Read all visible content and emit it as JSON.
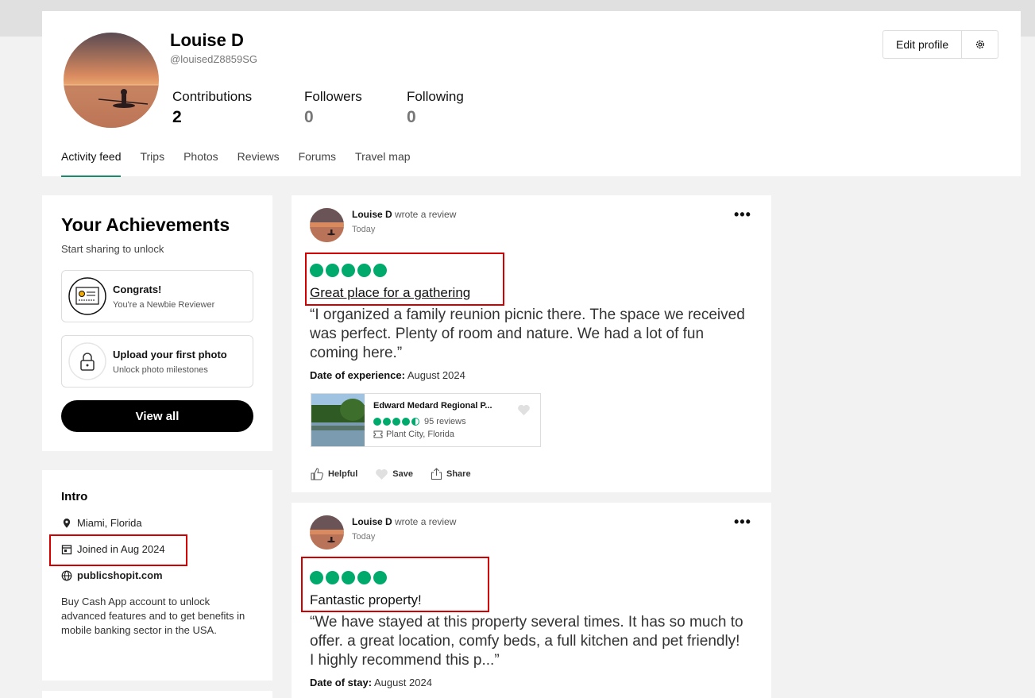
{
  "profile": {
    "name": "Louise D",
    "handle": "@louisedZ8859SG",
    "stats": [
      {
        "label": "Contributions",
        "value": "2"
      },
      {
        "label": "Followers",
        "value": "0"
      },
      {
        "label": "Following",
        "value": "0"
      }
    ],
    "edit_label": "Edit profile"
  },
  "tabs": [
    {
      "label": "Activity feed",
      "active": true
    },
    {
      "label": "Trips"
    },
    {
      "label": "Photos"
    },
    {
      "label": "Reviews"
    },
    {
      "label": "Forums"
    },
    {
      "label": "Travel map"
    }
  ],
  "achievements": {
    "title": "Your Achievements",
    "subtitle": "Start sharing to unlock",
    "items": [
      {
        "title": "Congrats!",
        "subtitle": "You're a Newbie Reviewer"
      },
      {
        "title": "Upload your first photo",
        "subtitle": "Unlock photo milestones"
      }
    ],
    "view_all": "View all"
  },
  "intro": {
    "title": "Intro",
    "location": "Miami, Florida",
    "joined": "Joined in Aug 2024",
    "website": "publicshopit.com",
    "bio": "Buy Cash App account to unlock advanced features and to get benefits in mobile banking sector in the USA."
  },
  "reviews": [
    {
      "author": "Louise D",
      "action": "wrote a review",
      "date": "Today",
      "rating": 5,
      "title": "Great place for a gathering",
      "body": "“I organized a family reunion picnic there. The space we received was perfect. Plenty of room and nature. We had a lot of fun coming here.”",
      "exp_label": "Date of experience:",
      "exp_value": "August 2024",
      "place": {
        "name": "Edward Medard Regional P...",
        "rating": 4.5,
        "reviews": "95 reviews",
        "location": "Plant City, Florida"
      },
      "actions": [
        "Helpful",
        "Save",
        "Share"
      ]
    },
    {
      "author": "Louise D",
      "action": "wrote a review",
      "date": "Today",
      "rating": 5,
      "title": "Fantastic property!",
      "body": "“We have stayed at this property several times. It has so much to offer. a great location, comfy beds, a full kitchen and pet friendly! I highly recommend this p...”",
      "exp_label": "Date of stay:",
      "exp_value": "August 2024"
    }
  ],
  "colors": {
    "rating_green": "#00aa6c",
    "highlight_red": "#d20000",
    "tab_underline": "#1a8a6c"
  }
}
